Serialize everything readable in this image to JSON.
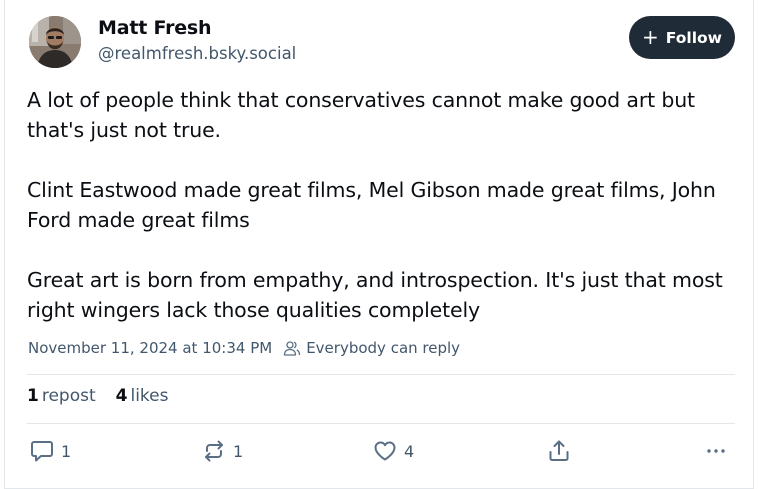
{
  "author": {
    "name": "Matt Fresh",
    "handle": "@realmfresh.bsky.social"
  },
  "follow_button": {
    "icon": "plus-icon",
    "label": "Follow"
  },
  "post": {
    "paragraphs": [
      "A lot of people think that conservatives cannot make good art but that's just not true.",
      "Clint Eastwood made great films, Mel Gibson made great films, John Ford made great films",
      "Great art is born from empathy, and introspection. It's just that most right wingers lack those qualities completely"
    ],
    "timestamp": "November 11, 2024 at 10:34 PM",
    "reply_setting": "Everybody can reply"
  },
  "stats": {
    "reposts_count": "1",
    "reposts_label": "repost",
    "likes_count": "4",
    "likes_label": "likes"
  },
  "actions": {
    "reply_count": "1",
    "repost_count": "1",
    "like_count": "4"
  },
  "colors": {
    "follow_bg": "#202b38",
    "text": "#0b0f14",
    "muted": "#42576c",
    "icon": "#5b6f84",
    "divider": "#e3e6ea"
  }
}
